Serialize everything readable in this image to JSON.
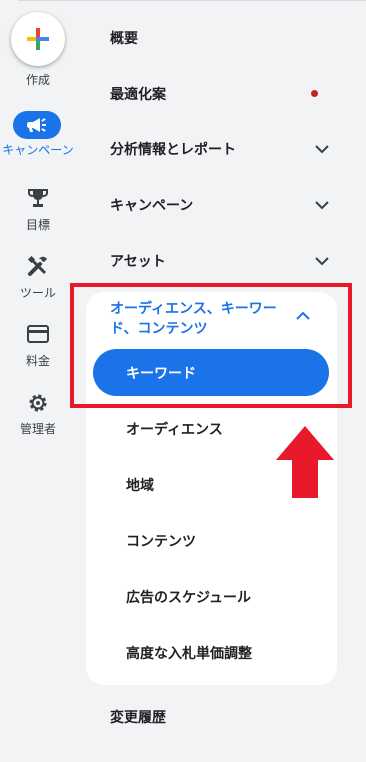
{
  "rail": {
    "create_label": "作成",
    "campaigns_label": "キャンペーン",
    "goals_label": "目標",
    "tools_label": "ツール",
    "billing_label": "料金",
    "admin_label": "管理者"
  },
  "nav": {
    "overview": "概要",
    "recommendations": "最適化案",
    "insights_reports": "分析情報とレポート",
    "campaigns": "キャンペーン",
    "assets": "アセット"
  },
  "panel": {
    "title": "オーディエンス、キーワード、コンテンツ",
    "items": [
      "キーワード",
      "オーディエンス",
      "地域",
      "コンテンツ",
      "広告のスケジュール",
      "高度な入札単価調整"
    ]
  },
  "change_history": "変更履歴",
  "colors": {
    "accent": "#1a73e8",
    "highlight": "#e8192b",
    "alert_dot": "#c5221f"
  }
}
